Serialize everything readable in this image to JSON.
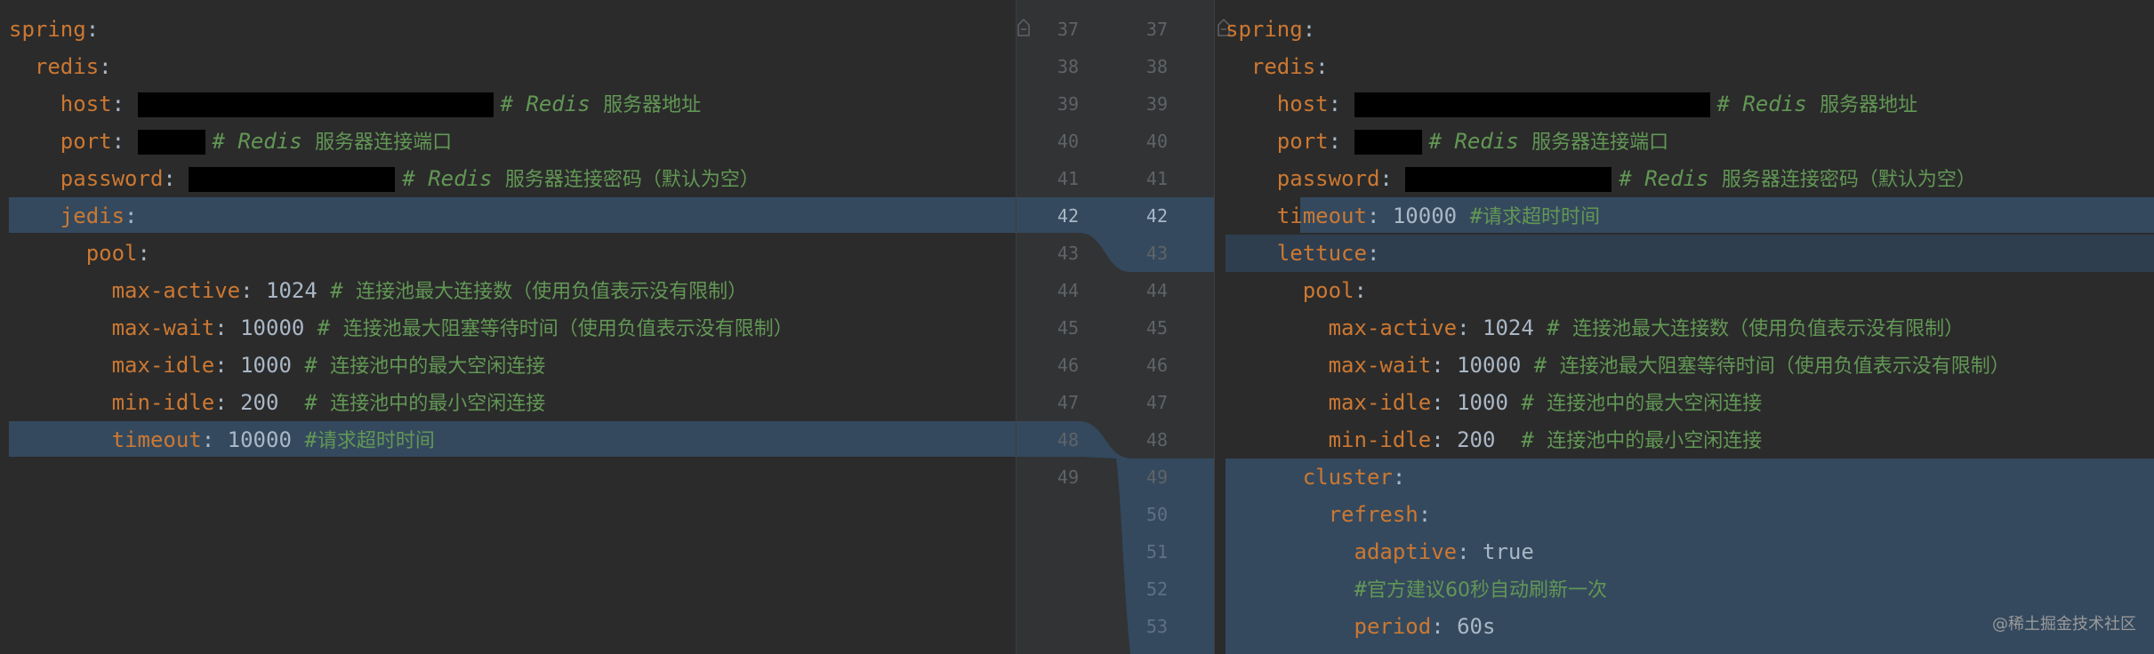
{
  "left": {
    "lines": [
      {
        "indent": "",
        "key": "spring",
        "sep": ":",
        "value": "",
        "comment": "",
        "comment_cn": ""
      },
      {
        "indent": "  ",
        "key": "redis",
        "sep": ":",
        "value": "",
        "comment": "",
        "comment_cn": ""
      },
      {
        "indent": "    ",
        "key": "host",
        "sep": ": ",
        "value": "",
        "comment": "# Redis ",
        "comment_cn": "服务器地址"
      },
      {
        "indent": "    ",
        "key": "port",
        "sep": ": ",
        "value": "",
        "comment": "# Redis ",
        "comment_cn": "服务器连接端口"
      },
      {
        "indent": "    ",
        "key": "password",
        "sep": ": ",
        "value": "",
        "comment": "# Redis ",
        "comment_cn": "服务器连接密码（默认为空）"
      },
      {
        "indent": "    ",
        "key": "jedis",
        "sep": ":",
        "value": "",
        "comment": "",
        "comment_cn": ""
      },
      {
        "indent": "      ",
        "key": "pool",
        "sep": ":",
        "value": "",
        "comment": "",
        "comment_cn": ""
      },
      {
        "indent": "        ",
        "key": "max-active",
        "sep": ": ",
        "value": "1024 ",
        "comment": "# ",
        "comment_cn": "连接池最大连接数（使用负值表示没有限制）"
      },
      {
        "indent": "        ",
        "key": "max-wait",
        "sep": ": ",
        "value": "10000 ",
        "comment": "# ",
        "comment_cn": "连接池最大阻塞等待时间（使用负值表示没有限制）"
      },
      {
        "indent": "        ",
        "key": "max-idle",
        "sep": ": ",
        "value": "1000 ",
        "comment": "# ",
        "comment_cn": "连接池中的最大空闲连接"
      },
      {
        "indent": "        ",
        "key": "min-idle",
        "sep": ": ",
        "value": "200  ",
        "comment": "# ",
        "comment_cn": "连接池中的最小空闲连接"
      },
      {
        "indent": "        ",
        "key": "timeout",
        "sep": ": ",
        "value": "10000 ",
        "comment": "#",
        "comment_cn": "请求超时时间"
      }
    ]
  },
  "right": {
    "lines": [
      {
        "indent": "",
        "key": "spring",
        "sep": ":",
        "value": "",
        "comment": "",
        "comment_cn": ""
      },
      {
        "indent": "  ",
        "key": "redis",
        "sep": ":",
        "value": "",
        "comment": "",
        "comment_cn": ""
      },
      {
        "indent": "    ",
        "key": "host",
        "sep": ": ",
        "value": "",
        "comment": "# Redis ",
        "comment_cn": "服务器地址"
      },
      {
        "indent": "    ",
        "key": "port",
        "sep": ": ",
        "value": "",
        "comment": "# Redis ",
        "comment_cn": "服务器连接端口"
      },
      {
        "indent": "    ",
        "key": "password",
        "sep": ": ",
        "value": "",
        "comment": "# Redis ",
        "comment_cn": "服务器连接密码（默认为空）"
      },
      {
        "indent": "    ",
        "key": "timeout",
        "sep": ": ",
        "value": "10000 ",
        "comment": "#",
        "comment_cn": "请求超时时间"
      },
      {
        "indent": "    ",
        "key": "lettuce",
        "sep": ":",
        "value": "",
        "comment": "",
        "comment_cn": ""
      },
      {
        "indent": "      ",
        "key": "pool",
        "sep": ":",
        "value": "",
        "comment": "",
        "comment_cn": ""
      },
      {
        "indent": "        ",
        "key": "max-active",
        "sep": ": ",
        "value": "1024 ",
        "comment": "# ",
        "comment_cn": "连接池最大连接数（使用负值表示没有限制）"
      },
      {
        "indent": "        ",
        "key": "max-wait",
        "sep": ": ",
        "value": "10000 ",
        "comment": "# ",
        "comment_cn": "连接池最大阻塞等待时间（使用负值表示没有限制）"
      },
      {
        "indent": "        ",
        "key": "max-idle",
        "sep": ": ",
        "value": "1000 ",
        "comment": "# ",
        "comment_cn": "连接池中的最大空闲连接"
      },
      {
        "indent": "        ",
        "key": "min-idle",
        "sep": ": ",
        "value": "200  ",
        "comment": "# ",
        "comment_cn": "连接池中的最小空闲连接"
      },
      {
        "indent": "      ",
        "key": "cluster",
        "sep": ":",
        "value": "",
        "comment": "",
        "comment_cn": ""
      },
      {
        "indent": "        ",
        "key": "refresh",
        "sep": ":",
        "value": "",
        "comment": "",
        "comment_cn": ""
      },
      {
        "indent": "          ",
        "key": "adaptive",
        "sep": ": ",
        "value": "true",
        "comment": "",
        "comment_cn": ""
      },
      {
        "indent": "          ",
        "key": "",
        "sep": "",
        "value": "",
        "comment": "#",
        "comment_cn": "官方建议60秒自动刷新一次"
      },
      {
        "indent": "          ",
        "key": "period",
        "sep": ": ",
        "value": "60s",
        "comment": "",
        "comment_cn": ""
      }
    ]
  },
  "gutter": {
    "left_numbers": [
      "37",
      "38",
      "39",
      "40",
      "41",
      "42",
      "43",
      "44",
      "45",
      "46",
      "47",
      "48",
      "49"
    ],
    "right_numbers": [
      "37",
      "38",
      "39",
      "40",
      "41",
      "42",
      "43",
      "44",
      "45",
      "46",
      "47",
      "48",
      "49",
      "50",
      "51",
      "52",
      "53"
    ]
  },
  "watermark": "@稀土掘金技术社区",
  "colors": {
    "background": "#2b2b2b",
    "key": "#cc7832",
    "value": "#a9b7c6",
    "comment": "#629755",
    "diff_highlight": "#34495e"
  }
}
